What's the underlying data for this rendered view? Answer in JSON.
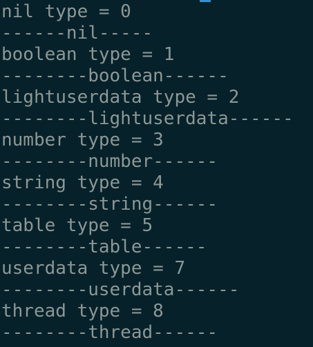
{
  "terminal": {
    "lines": [
      "nil type = 0",
      "------nil-----",
      "boolean type = 1",
      "--------boolean------",
      "lightuserdata type = 2",
      "--------lightuserdata------",
      "number type = 3",
      "--------number------",
      "string type = 4",
      "--------string------",
      "table type = 5",
      "--------table------",
      "userdata type = 7",
      "--------userdata------",
      "thread type = 8",
      "--------thread------"
    ]
  },
  "colors": {
    "background": "#062129",
    "text": "#8c9796",
    "cursor": "#3a8fd0"
  }
}
